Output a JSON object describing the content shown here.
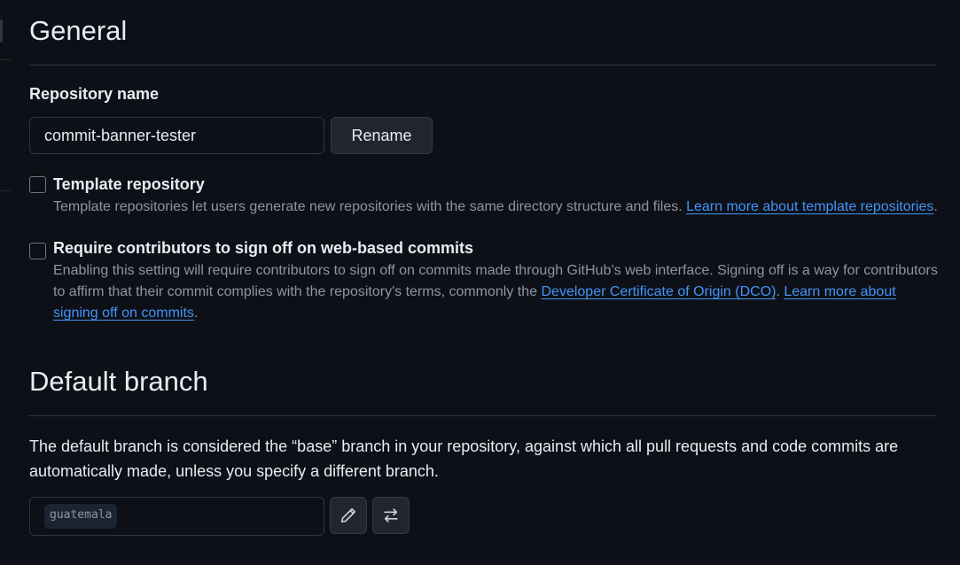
{
  "general": {
    "title": "General",
    "repo_label": "Repository name",
    "repo_value": "commit-banner-tester",
    "rename_label": "Rename"
  },
  "template": {
    "title": "Template repository",
    "desc": "Template repositories let users generate new repositories with the same directory structure and files. ",
    "link": "Learn more about template repositories",
    "period": "."
  },
  "signoff": {
    "title": "Require contributors to sign off on web-based commits",
    "desc_a": "Enabling this setting will require contributors to sign off on commits made through GitHub’s web interface. Signing off is a way for contributors to affirm that their commit complies with the repository's terms, commonly the ",
    "link_dco": "Developer Certificate of Origin (DCO)",
    "desc_b": ". ",
    "link_more": "Learn more about signing off on commits",
    "period": "."
  },
  "default_branch": {
    "title": "Default branch",
    "description": "The default branch is considered the “base” branch in your repository, against which all pull requests and code commits are automatically made, unless you specify a different branch.",
    "branch_name": "guatemala"
  },
  "icons": {
    "edit": "pencil-icon",
    "switch": "arrow-switch-icon"
  },
  "colors": {
    "background": "#0d1117",
    "link": "#4493f8",
    "muted_text": "#8d96a0",
    "border": "#30363d"
  }
}
